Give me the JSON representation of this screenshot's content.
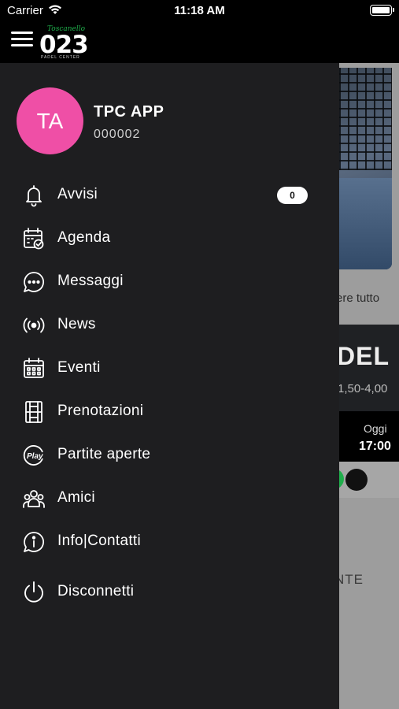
{
  "status_bar": {
    "carrier": "Carrier",
    "time": "11:18 AM"
  },
  "header": {
    "logo_script": "Toscanello",
    "logo_number": "023",
    "logo_sub": "PADEL CENTER"
  },
  "background": {
    "see_all": "ere tutto",
    "card_title": "DEL",
    "card_price": "1,50-4,00",
    "slot_day": "Oggi",
    "slot_time": "17:00",
    "bottom_text": "NTE"
  },
  "user": {
    "initials": "TA",
    "name": "TPC APP",
    "code": "000002",
    "avatar_color": "#ef4fa6"
  },
  "menu": [
    {
      "label": "Avvisi",
      "icon": "bell-icon",
      "badge": "0"
    },
    {
      "label": "Agenda",
      "icon": "calendar-check-icon"
    },
    {
      "label": "Messaggi",
      "icon": "chat-bubble-icon"
    },
    {
      "label": "News",
      "icon": "broadcast-icon"
    },
    {
      "label": "Eventi",
      "icon": "calendar-grid-icon"
    },
    {
      "label": "Prenotazioni",
      "icon": "court-icon"
    },
    {
      "label": "Partite aperte",
      "icon": "play-icon"
    },
    {
      "label": "Amici",
      "icon": "group-icon"
    },
    {
      "label": "Info|Contatti",
      "icon": "info-icon"
    },
    {
      "label": "Disconnetti",
      "icon": "power-icon"
    }
  ],
  "colors": {
    "drawer_bg": "#1e1e20",
    "accent_green": "#1fae4b"
  }
}
